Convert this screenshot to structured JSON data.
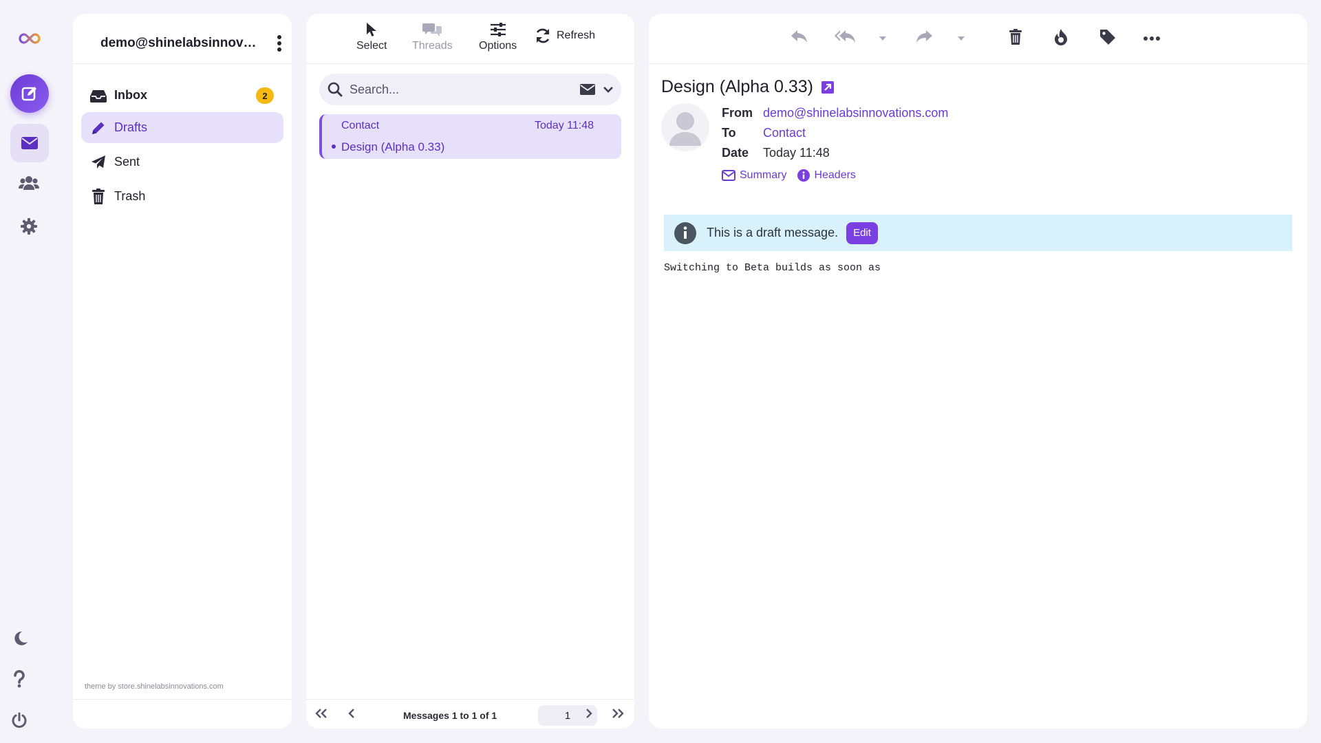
{
  "colors": {
    "accent": "#6a3ad8",
    "badge": "#f5b914",
    "draft_bar": "#d9f1fb"
  },
  "rail": {
    "icons": [
      "infinity-logo-icon",
      "compose-icon",
      "mail-icon",
      "contacts-icon",
      "settings-icon",
      "moon-icon",
      "help-icon",
      "power-icon"
    ]
  },
  "account": {
    "email": "demo@shinelabsinnovations.com"
  },
  "folders": [
    {
      "label": "Inbox",
      "icon": "inbox-icon",
      "unread": "2"
    },
    {
      "label": "Drafts",
      "icon": "pencil-icon"
    },
    {
      "label": "Sent",
      "icon": "paper-plane-icon"
    },
    {
      "label": "Trash",
      "icon": "trash-icon"
    }
  ],
  "theme_credit": "theme by store.shinelabsinnovations.com",
  "list_toolbar": {
    "select": "Select",
    "threads": "Threads",
    "options": "Options",
    "refresh": "Refresh"
  },
  "search": {
    "placeholder": "Search...",
    "value": ""
  },
  "messages": [
    {
      "from": "Contact",
      "time": "Today 11:48",
      "subject": "Design (Alpha 0.33)"
    }
  ],
  "pager": {
    "info": "Messages 1 to 1 of 1",
    "page": "1"
  },
  "reader": {
    "subject": "Design (Alpha 0.33)",
    "from_label": "From",
    "from": "demo@shinelabsinnovations.com",
    "to_label": "To",
    "to": "Contact",
    "date_label": "Date",
    "date": "Today 11:48",
    "summary": "Summary",
    "headers": "Headers",
    "draft_notice": "This is a draft message.",
    "edit": "Edit",
    "body": "Switching to Beta builds as soon as"
  }
}
